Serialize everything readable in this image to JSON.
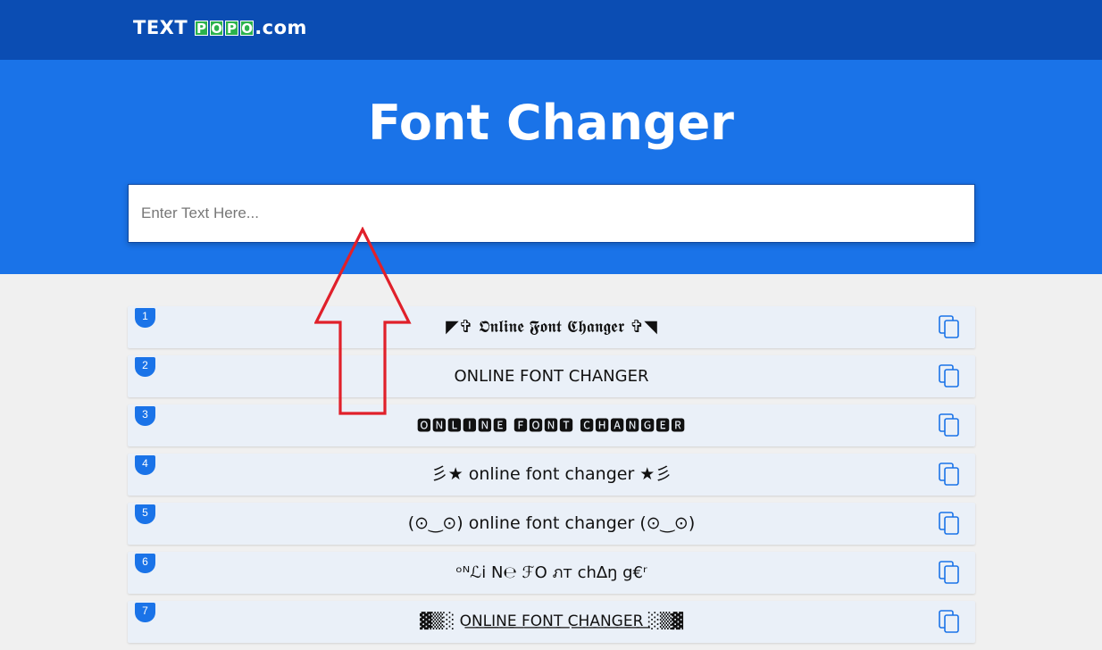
{
  "header": {
    "logo_prefix": "TEXT",
    "logo_boxes": [
      "P",
      "O",
      "P",
      "O"
    ],
    "logo_suffix": ".com"
  },
  "hero": {
    "title": "Font Changer",
    "input_placeholder": "Enter Text Here..."
  },
  "results": [
    {
      "index": "1",
      "text": "◤✞ 𝕺𝖓𝖑𝖎𝖓𝖊 𝕱𝖔𝖓𝖙 𝕮𝖍𝖆𝖓𝖌𝖊𝖗 ✞◥"
    },
    {
      "index": "2",
      "text": "ONLINE FONT CHANGER"
    },
    {
      "index": "3",
      "text": "🅾🅽🅻🅸🅽🅴 🅵🅾🅽🆃 🅲🅷🅰🅽🅶🅴🆁"
    },
    {
      "index": "4",
      "text": "彡★ online font changer ★彡"
    },
    {
      "index": "5",
      "text": "(⊙‿⊙) online font changer (⊙‿⊙)"
    },
    {
      "index": "6",
      "text": "ᵒᴺℒі N℮ ℱO ภт ch∆ŋ g€ʳ"
    },
    {
      "index": "7",
      "text": "▓▒░ O͟N͟L͟I͟N͟E͟ F͟O͟N͟T͟ C͟H͟A͟N͟G͟E͟R͟ ░▒▓"
    }
  ],
  "icons": {
    "copy": "copy-icon",
    "annotation": "up-arrow-icon"
  },
  "colors": {
    "topbar": "#0b4db3",
    "hero": "#1a73e8",
    "logo_box": "#2bb24c",
    "row_bg": "#eaf0f8",
    "badge": "#1a73e8",
    "arrow": "#e0202a"
  }
}
